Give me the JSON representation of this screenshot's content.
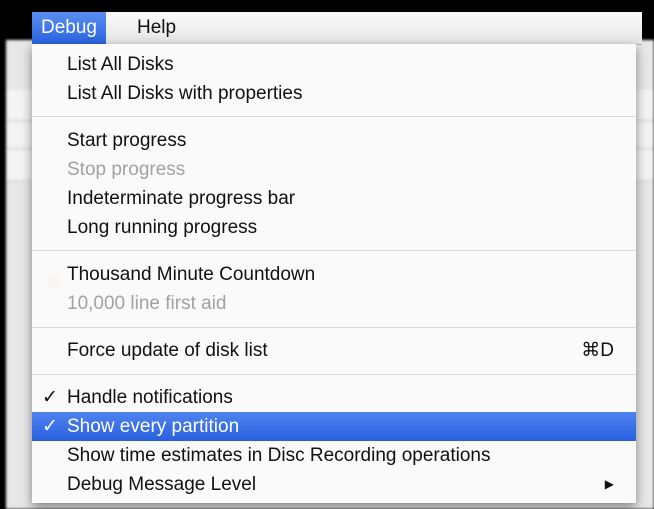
{
  "menubar": {
    "menus": [
      {
        "label": "Debug"
      },
      {
        "label": "Help"
      }
    ]
  },
  "debug_menu": {
    "groups": [
      {
        "items": [
          {
            "label": "List All Disks",
            "enabled": true
          },
          {
            "label": "List All Disks with properties",
            "enabled": true
          }
        ]
      },
      {
        "items": [
          {
            "label": "Start progress",
            "enabled": true
          },
          {
            "label": "Stop progress",
            "enabled": false
          },
          {
            "label": "Indeterminate progress bar",
            "enabled": true
          },
          {
            "label": "Long running progress",
            "enabled": true
          }
        ]
      },
      {
        "items": [
          {
            "label": "Thousand Minute Countdown",
            "enabled": true
          },
          {
            "label": "10,000 line first aid",
            "enabled": false
          }
        ]
      },
      {
        "items": [
          {
            "label": "Force update of disk list",
            "enabled": true,
            "shortcut": "⌘D"
          }
        ]
      },
      {
        "items": [
          {
            "label": "Handle notifications",
            "enabled": true,
            "checked": true
          },
          {
            "label": "Show every partition",
            "enabled": true,
            "checked": true,
            "highlighted": true
          },
          {
            "label": "Show time estimates in Disc Recording operations",
            "enabled": true
          },
          {
            "label": "Debug Message Level",
            "enabled": true,
            "submenu": true
          }
        ]
      }
    ],
    "check_glyph": "✓",
    "submenu_glyph": "▶"
  },
  "colors": {
    "highlight": "#2f66e3",
    "disabled_text": "#a2a2a2",
    "menubar_bg": "#ececec"
  }
}
